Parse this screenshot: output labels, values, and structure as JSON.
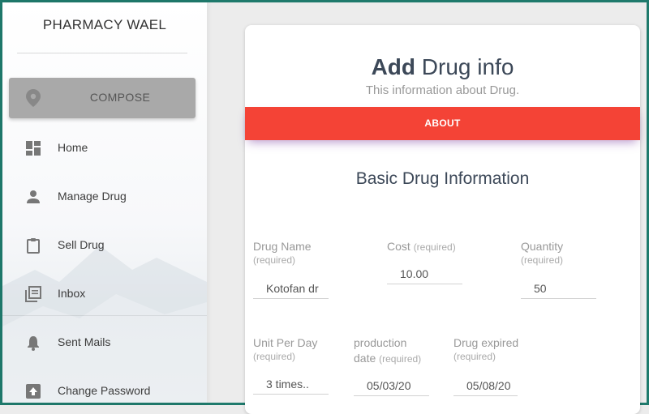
{
  "sidebar": {
    "brand": "PHARMACY WAEL",
    "compose_label": "COMPOSE",
    "items": [
      {
        "label": "Home",
        "icon": "dashboard-icon"
      },
      {
        "label": "Manage Drug",
        "icon": "person-icon"
      },
      {
        "label": "Sell Drug",
        "icon": "clipboard-icon"
      },
      {
        "label": "Inbox",
        "icon": "library-books-icon"
      },
      {
        "label": "Sent Mails",
        "icon": "bell-icon"
      },
      {
        "label": "Change Password",
        "icon": "upload-icon"
      }
    ]
  },
  "card": {
    "title_bold": "Add",
    "title_rest": " Drug info",
    "subtitle": "This information about Drug.",
    "tab_label": "ABOUT",
    "section_title": "Basic Drug Information",
    "fields": {
      "drug_name": {
        "label": "Drug Name",
        "req": "(required)",
        "value": "Kotofan dr"
      },
      "cost": {
        "label": "Cost",
        "req": "(required)",
        "value": "10.00"
      },
      "quantity": {
        "label": "Quantity",
        "req": "(required)",
        "value": "50"
      },
      "unit_per_day": {
        "label": "Unit Per Day",
        "req": "(required)",
        "value": "3 times.."
      },
      "production_date": {
        "label": "production",
        "label2": "date",
        "req": "(required)",
        "value": "05/03/20"
      },
      "drug_expired": {
        "label": "Drug expired",
        "req": "(required)",
        "value": "05/08/20"
      }
    }
  },
  "colors": {
    "accent_red": "#f44336",
    "compose_bg": "#a9a9a9",
    "frame": "#1f7a6c"
  }
}
